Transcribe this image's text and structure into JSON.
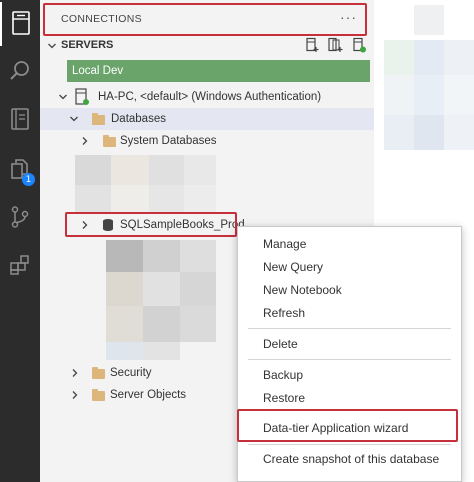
{
  "activity_bar": {
    "badge_count": "1"
  },
  "connections": {
    "title": "CONNECTIONS",
    "more_label": "···"
  },
  "servers": {
    "title": "SERVERS"
  },
  "tree": {
    "group": "Local Dev",
    "server": "HA-PC, <default> (Windows Authentication)",
    "databases": "Databases",
    "system_databases": "System Databases",
    "database": "SQLSampleBooks_Prod",
    "security": "Security",
    "server_objects": "Server Objects"
  },
  "context_menu": {
    "items": [
      "Manage",
      "New Query",
      "New Notebook",
      "Refresh",
      "Delete",
      "Backup",
      "Restore",
      "Data-tier Application wizard",
      "Create snapshot of this database"
    ]
  },
  "colors": {
    "activity_bg": "#2c2c2c",
    "panel_bg": "#f3f3f3",
    "group_bar": "#6aa46a",
    "highlight_box": "#c5303a",
    "badge": "#1a85ff",
    "connected_dot": "#3fa53f",
    "folder": "#dcb67a"
  }
}
